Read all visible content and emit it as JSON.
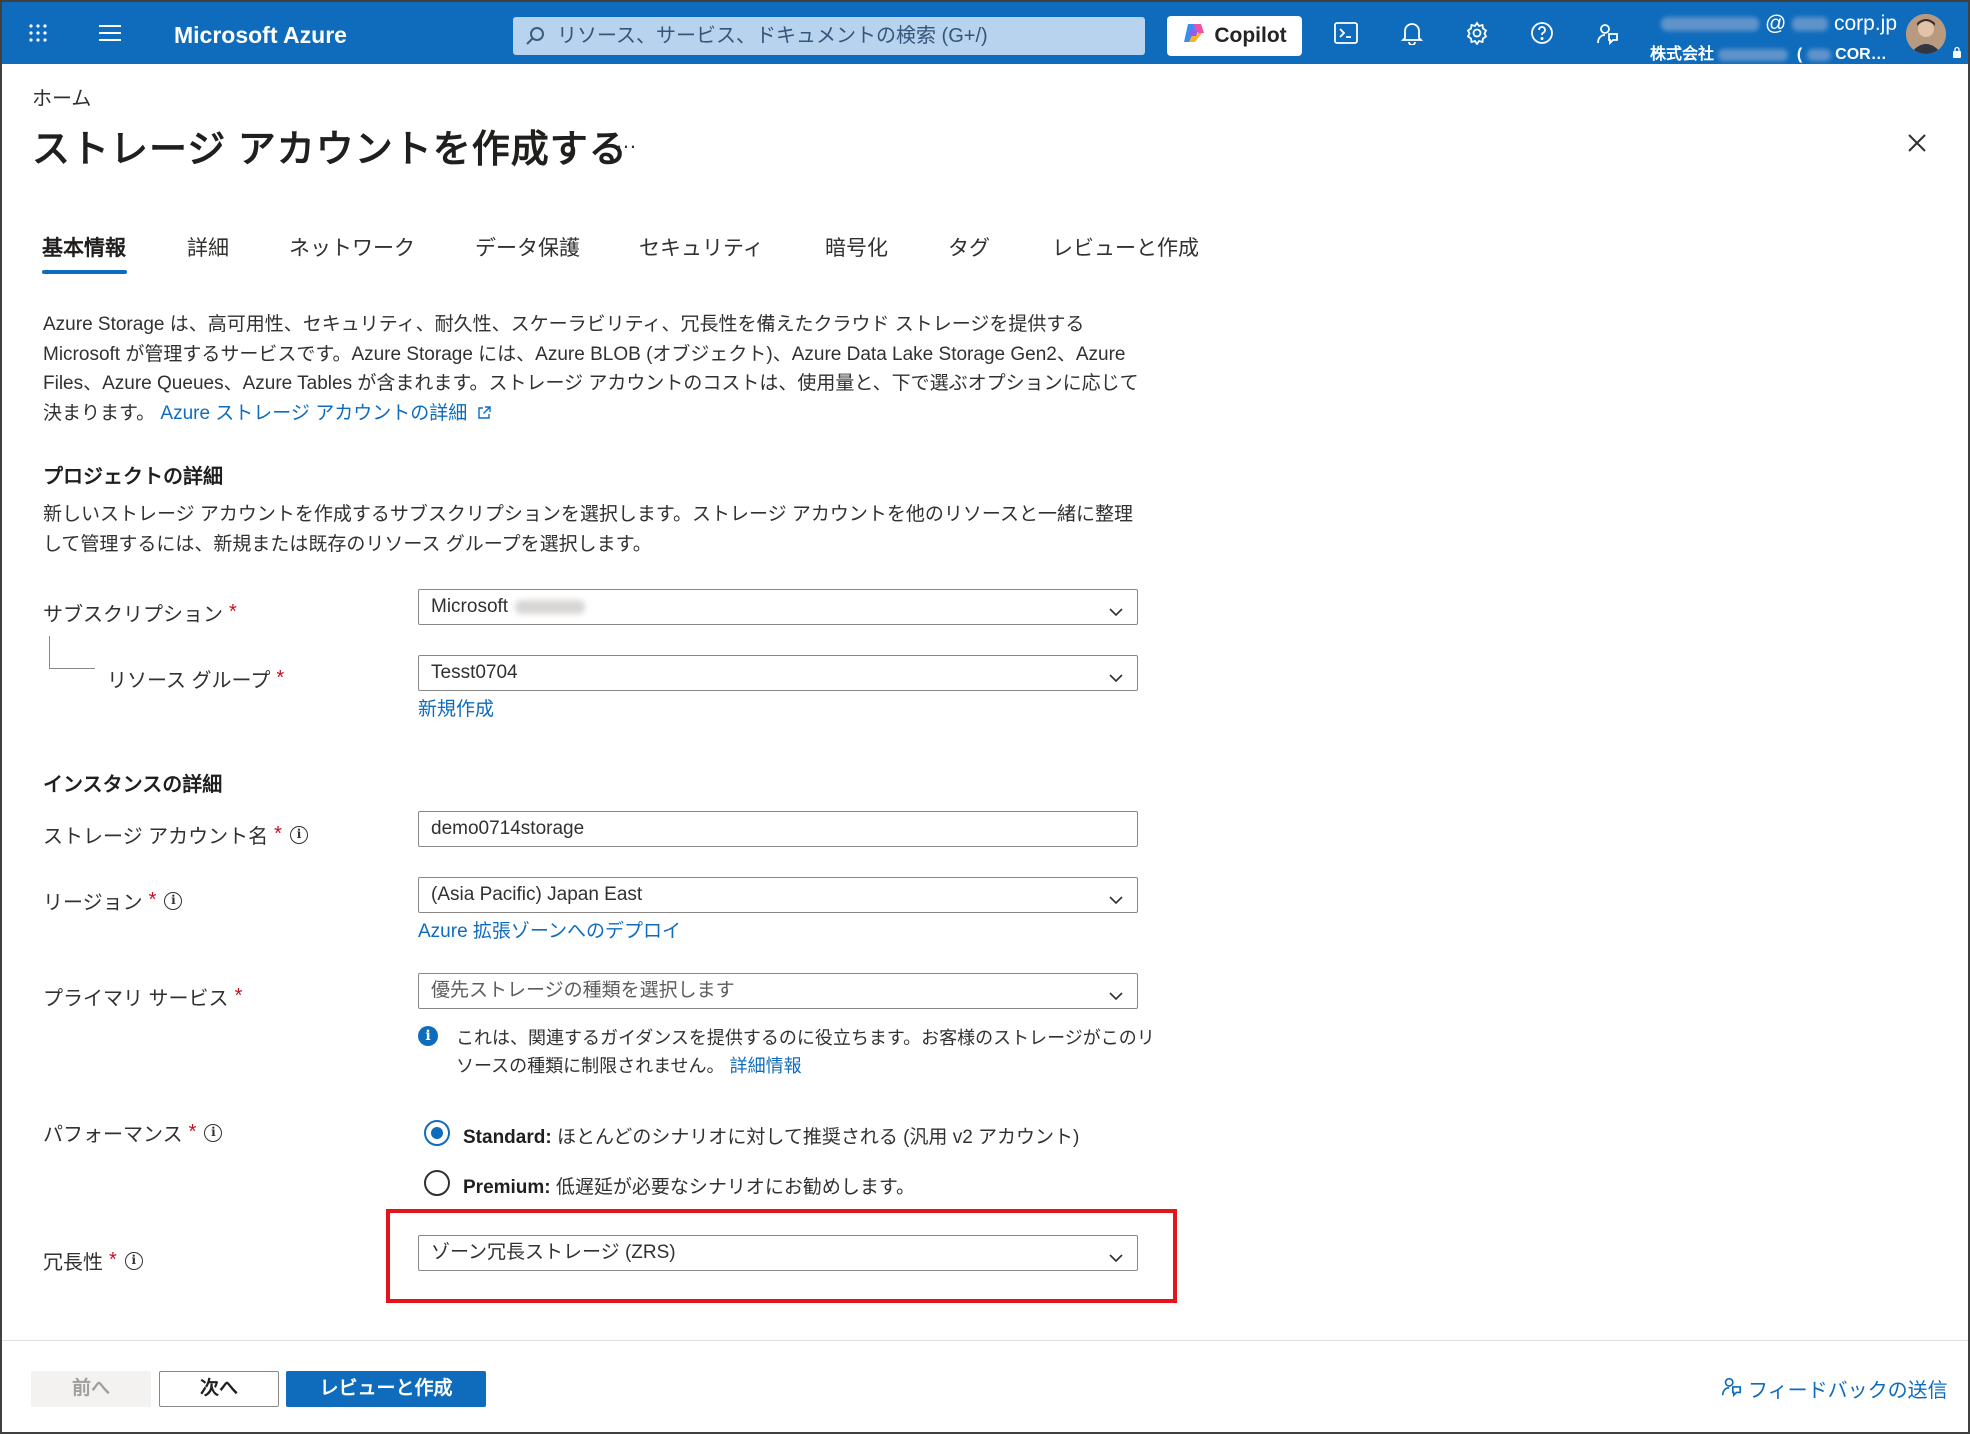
{
  "topbar": {
    "brand": "Microsoft Azure",
    "search_placeholder": "リソース、サービス、ドキュメントの検索 (G+/)",
    "copilot_label": "Copilot",
    "account_at": "@",
    "account_domain": "corp.jp",
    "account_company": "株式会社",
    "account_dir_suffix": "COR…"
  },
  "header": {
    "breadcrumb": "ホーム",
    "title": "ストレージ アカウントを作成する",
    "more": "…"
  },
  "tabs": [
    {
      "label": "基本情報"
    },
    {
      "label": "詳細"
    },
    {
      "label": "ネットワーク"
    },
    {
      "label": "データ保護"
    },
    {
      "label": "セキュリティ"
    },
    {
      "label": "暗号化"
    },
    {
      "label": "タグ"
    },
    {
      "label": "レビューと作成"
    }
  ],
  "intro": {
    "text": "Azure Storage は、高可用性、セキュリティ、耐久性、スケーラビリティ、冗長性を備えたクラウド ストレージを提供する Microsoft が管理するサービスです。Azure Storage には、Azure BLOB (オブジェクト)、Azure Data Lake Storage Gen2、Azure Files、Azure Queues、Azure Tables が含まれます。ストレージ アカウントのコストは、使用量と、下で選ぶオプションに応じて決まります。",
    "link": "Azure ストレージ アカウントの詳細"
  },
  "project": {
    "heading": "プロジェクトの詳細",
    "desc": "新しいストレージ アカウントを作成するサブスクリプションを選択します。ストレージ アカウントを他のリソースと一緒に整理して管理するには、新規または既存のリソース グループを選択します。",
    "subscription_label": "サブスクリプション",
    "subscription_value": "Microsoft",
    "rg_label": "リソース グループ",
    "rg_value": "Tesst0704",
    "rg_new": "新規作成"
  },
  "instance": {
    "heading": "インスタンスの詳細",
    "name_label": "ストレージ アカウント名",
    "name_value": "demo0714storage",
    "region_label": "リージョン",
    "region_value": "(Asia Pacific) Japan East",
    "region_link": "Azure 拡張ゾーンへのデプロイ",
    "primary_label": "プライマリ サービス",
    "primary_placeholder": "優先ストレージの種類を選択します",
    "primary_info": "これは、関連するガイダンスを提供するのに役立ちます。お客様のストレージがこのリソースの種類に制限されません。",
    "primary_info_link": "詳細情報",
    "performance_label": "パフォーマンス",
    "perf_standard_bold": "Standard:",
    "perf_standard_text": "ほとんどのシナリオに対して推奨される (汎用 v2 アカウント)",
    "perf_premium_bold": "Premium:",
    "perf_premium_text": "低遅延が必要なシナリオにお勧めします。",
    "redundancy_label": "冗長性",
    "redundancy_value": "ゾーン冗長ストレージ (ZRS)"
  },
  "required_mark": "*",
  "footer": {
    "prev": "前へ",
    "next": "次へ",
    "create": "レビューと作成",
    "feedback": "フィードバックの送信"
  },
  "colors": {
    "accent": "#0f6cbd",
    "highlight": "#e3141b",
    "required": "#c50f1f"
  }
}
